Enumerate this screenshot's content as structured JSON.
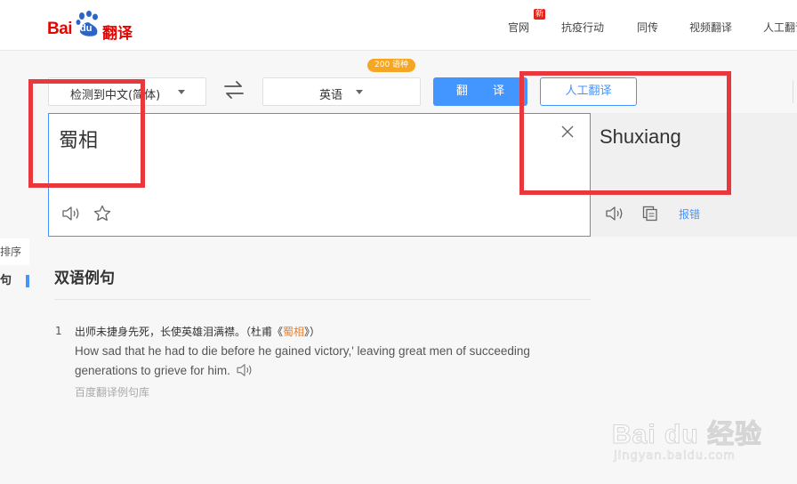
{
  "logo": {
    "bai": "Bai",
    "du": "du",
    "fanyi": "翻译"
  },
  "nav": {
    "items": [
      "官网",
      "抗疫行动",
      "同传",
      "视频翻译",
      "人工翻译"
    ],
    "new_badge": "新"
  },
  "controls": {
    "source_lang": "检测到中文(简体)",
    "target_lang": "英语",
    "lang_count_badge": "200 语种",
    "translate_button": "翻 译",
    "human_translate_button": "人工翻译"
  },
  "input": {
    "text": "蜀相"
  },
  "output": {
    "text": "Shuxiang",
    "report_label": "报错"
  },
  "side_tabs": {
    "sort": "排序",
    "sentence": "句"
  },
  "examples": {
    "title": "双语例句",
    "items": [
      {
        "number": "1",
        "cn_prefix": "出师未捷身先死，长使英雄泪满襟。（杜甫《",
        "cn_highlight": "蜀相",
        "cn_suffix": "》）",
        "en": "How sad that he had to die before he gained victory,' leaving great men of succeeding generations to grieve for him."
      }
    ],
    "source": "百度翻译例句库"
  },
  "watermark": {
    "text": "Bai du 经验",
    "url": "jingyan.baidu.com"
  },
  "colors": {
    "accent": "#4395ff",
    "brand_red": "#e10602",
    "highlight_box": "#e8383d",
    "badge": "#f5a623"
  }
}
